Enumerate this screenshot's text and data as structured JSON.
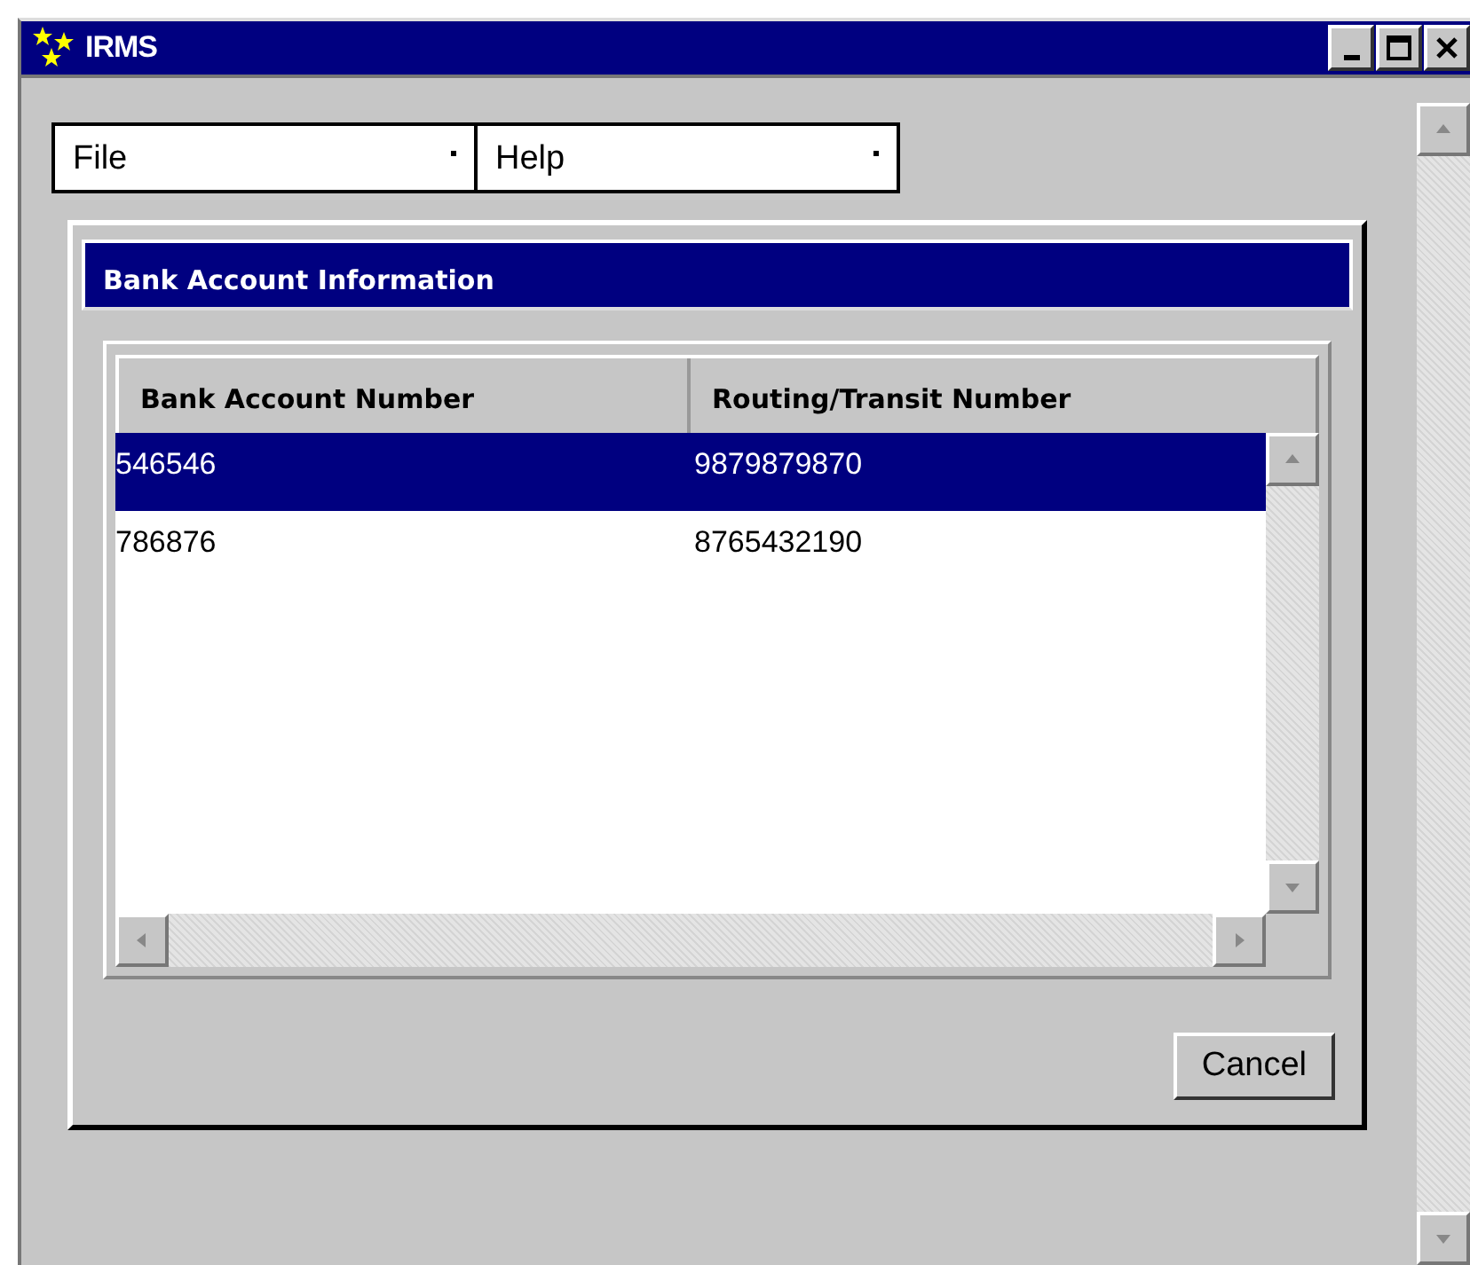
{
  "window": {
    "title": "IRMS"
  },
  "menu": [
    {
      "label": "File"
    },
    {
      "label": "Help"
    }
  ],
  "panel": {
    "title": "Bank Account Information"
  },
  "table": {
    "columns": [
      "Bank Account Number",
      "Routing/Transit Number"
    ],
    "rows": [
      {
        "cells": [
          "546546",
          "9879879870"
        ],
        "selected": true
      },
      {
        "cells": [
          "786876",
          "8765432190"
        ],
        "selected": false
      }
    ]
  },
  "buttons": [
    {
      "label": "Cancel"
    }
  ]
}
